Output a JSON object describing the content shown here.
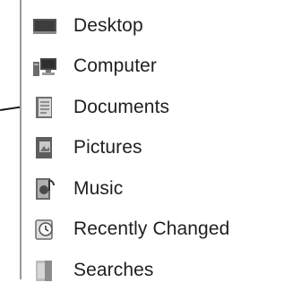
{
  "nav": {
    "items": [
      {
        "label": "Desktop",
        "icon": "desktop-icon"
      },
      {
        "label": "Computer",
        "icon": "computer-icon"
      },
      {
        "label": "Documents",
        "icon": "documents-icon"
      },
      {
        "label": "Pictures",
        "icon": "pictures-icon"
      },
      {
        "label": "Music",
        "icon": "music-icon"
      },
      {
        "label": "Recently Changed",
        "icon": "recently-changed-icon"
      },
      {
        "label": "Searches",
        "icon": "searches-icon"
      }
    ]
  }
}
